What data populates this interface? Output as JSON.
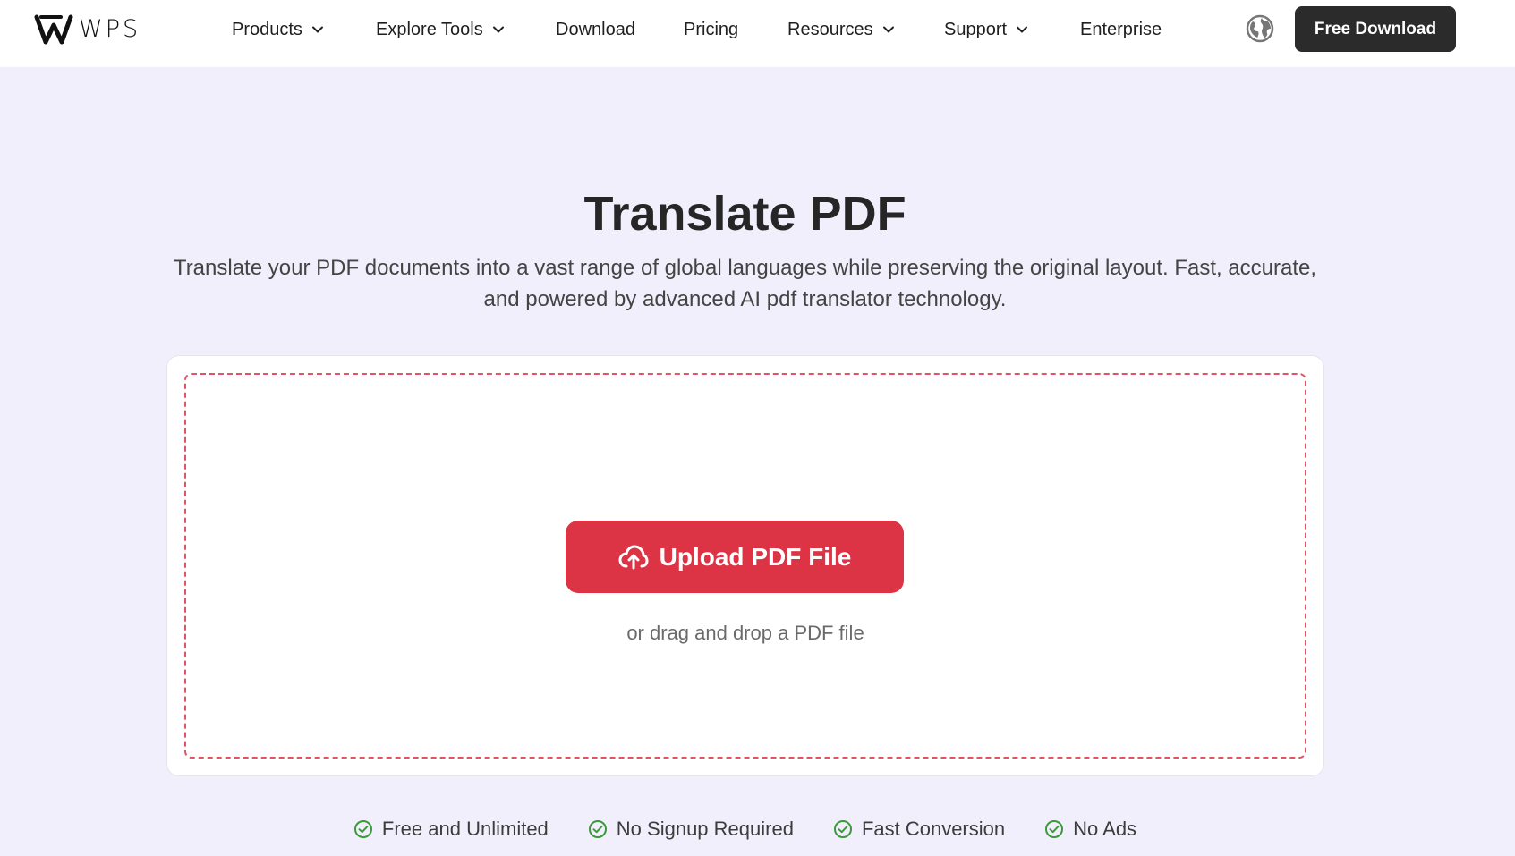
{
  "header": {
    "logo_text": "WPS",
    "nav": [
      {
        "label": "Products",
        "dropdown": true
      },
      {
        "label": "Explore Tools",
        "dropdown": true
      },
      {
        "label": "Download",
        "dropdown": false
      },
      {
        "label": "Pricing",
        "dropdown": false
      },
      {
        "label": "Resources",
        "dropdown": true
      },
      {
        "label": "Support",
        "dropdown": true
      },
      {
        "label": "Enterprise",
        "dropdown": false
      }
    ],
    "language_icon": "globe-icon",
    "cta_label": "Free Download"
  },
  "hero": {
    "title": "Translate PDF",
    "subtitle": "Translate your PDF documents into a vast range of global languages while preserving the original layout. Fast, accurate, and powered by advanced AI pdf translator technology."
  },
  "upload": {
    "button_label": "Upload PDF File",
    "button_icon": "cloud-upload-icon",
    "hint": "or drag and drop a PDF file"
  },
  "features": [
    {
      "label": "Free and Unlimited",
      "icon": "check-circle-icon"
    },
    {
      "label": "No Signup Required",
      "icon": "check-circle-icon"
    },
    {
      "label": "Fast Conversion",
      "icon": "check-circle-icon"
    },
    {
      "label": "No Ads",
      "icon": "check-circle-icon"
    }
  ],
  "colors": {
    "background": "#f2effc",
    "accent": "#dc3444",
    "dark_button": "#2b2b2b",
    "check_green": "#3a9a3a"
  }
}
